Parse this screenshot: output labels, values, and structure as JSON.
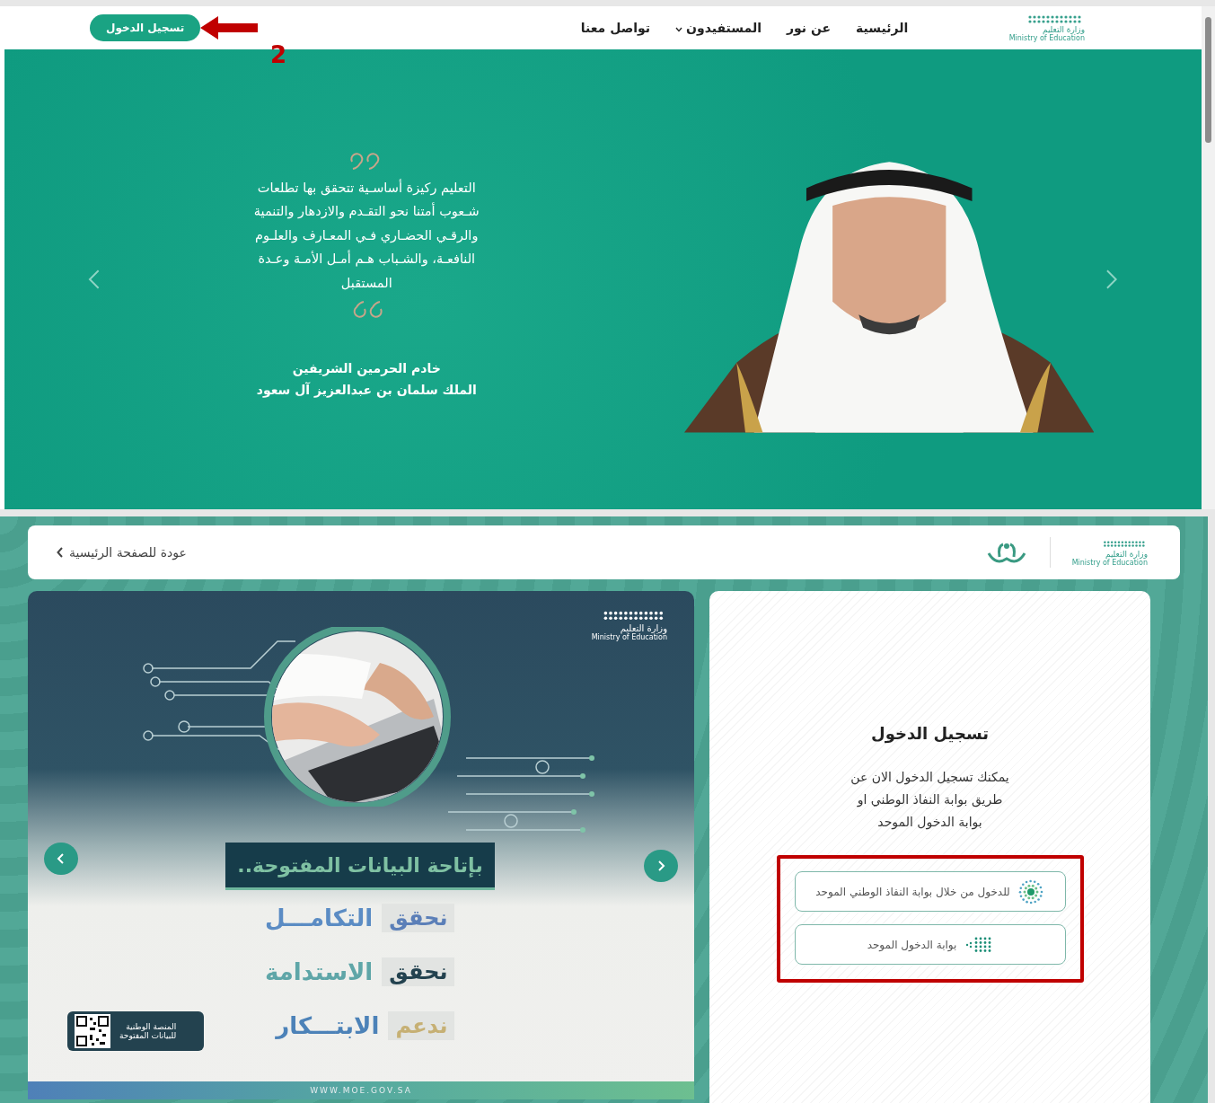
{
  "top_nav": {
    "logo": {
      "name_ar": "وزارة التعليم",
      "name_en": "Ministry of Education"
    },
    "links": [
      {
        "label": "الرئيسية",
        "has_menu": false
      },
      {
        "label": "عن نور",
        "has_menu": false
      },
      {
        "label": "المستفيدون",
        "has_menu": true
      },
      {
        "label": "تواصل معنا",
        "has_menu": false
      }
    ],
    "login_button": "تسجيل الدخول"
  },
  "annotation": {
    "step": "2"
  },
  "hero": {
    "quote": "التعليم ركيزة أساسـية تتحقق بها تطلعات\nشـعوب أمتنا نحو التقـدم والازدهار والتنمية\nوالرقـي الحضـاري فـي المعـارف والعلـوم\nالنافعـة، والشـباب هـم أمـل الأمـة وعـدة\nالمستقبل",
    "attribution": [
      "خادم الحرمين الشريفين",
      "الملك سلمان بن عبدالعزيز آل سعود"
    ],
    "picture": {
      "kind": "picture"
    }
  },
  "portal_header": {
    "back_link": "عودة للصفحة الرئيسية",
    "logo": {
      "name_ar": "وزارة التعليم",
      "name_en": "Ministry of Education"
    }
  },
  "banner": {
    "logo": {
      "name_ar": "وزارة التعليم",
      "name_en": "Ministry of Education"
    },
    "headline": "بإتاحة البيانات المفتوحة..",
    "slogans": [
      {
        "verb": "نحقق",
        "noun": "التكامـــل"
      },
      {
        "verb": "نحقق",
        "noun": "الاستدامة"
      },
      {
        "verb": "ندعم",
        "noun": "الابتـــكار"
      }
    ],
    "qr_label": "المنصة الوطنية\nللبيانات المفتوحة",
    "footer": "WWW.MOE.GOV.SA"
  },
  "login": {
    "title": "تسجيل الدخول",
    "description": "يمكنك تسجيل الدخول الان عن\nطريق بوابة النفاذ الوطني او\nبوابة الدخول الموحد",
    "options": [
      {
        "kind": "nafath",
        "label": "للدخول من خلال بوابة النفاذ الوطني الموحد"
      },
      {
        "kind": "unified",
        "label": "بوابة الدخول الموحد"
      }
    ]
  }
}
